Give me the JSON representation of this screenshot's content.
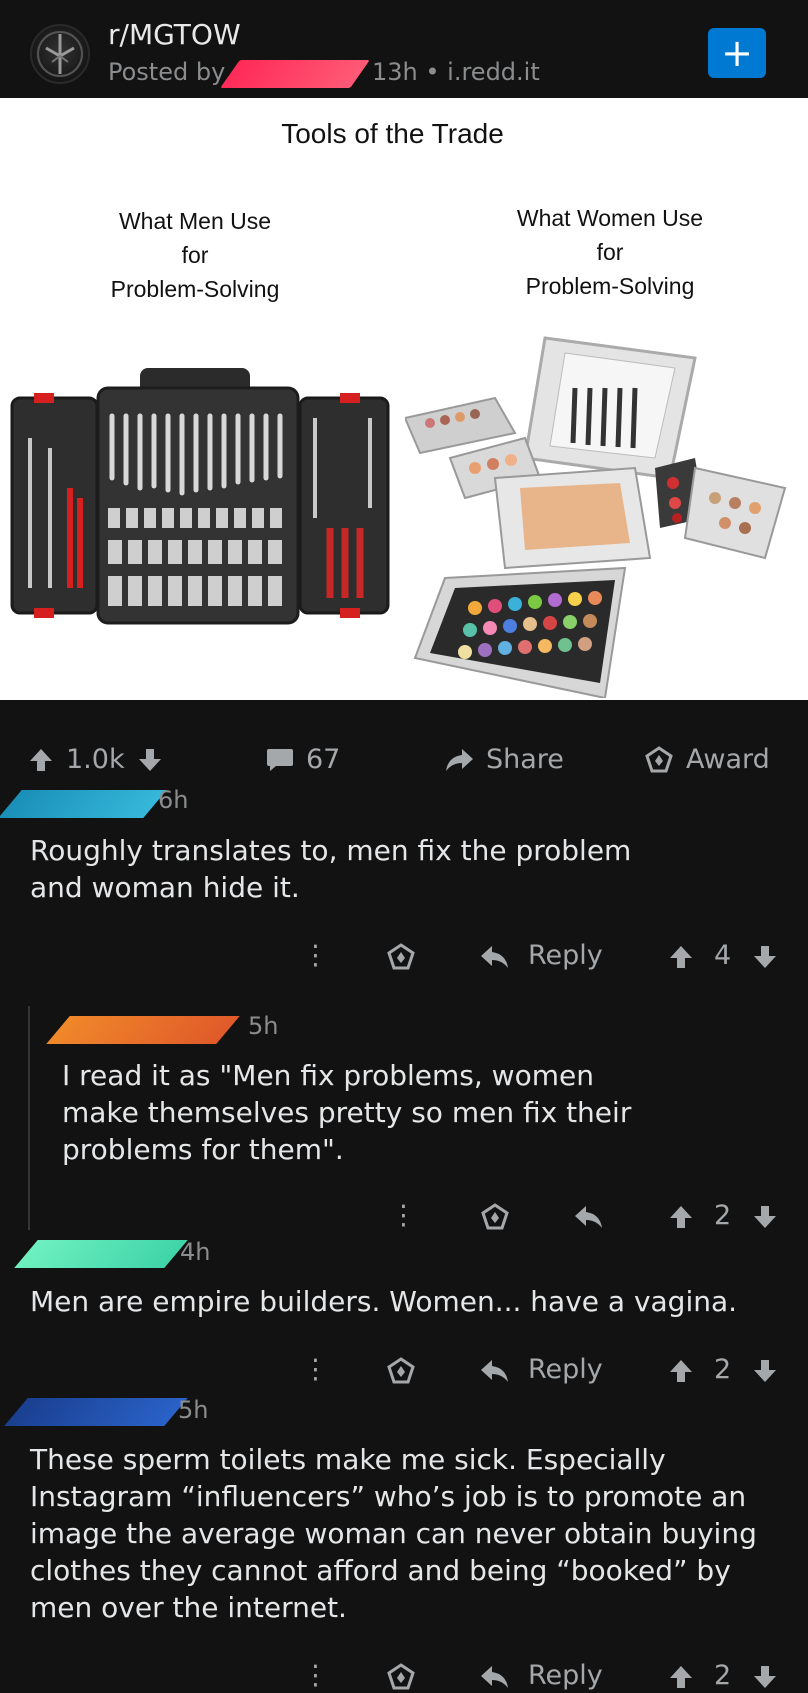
{
  "post": {
    "subreddit": "r/MGTOW",
    "posted_by_prefix": "Posted by",
    "age_domain": "13h • i.redd.it",
    "join_icon": "plus-icon"
  },
  "image": {
    "title": "Tools of the Trade",
    "left_label": [
      "What Men Use",
      "for",
      "Problem-Solving"
    ],
    "right_label": [
      "What Women Use",
      "for",
      "Problem-Solving"
    ]
  },
  "actions": {
    "upvotes": "1.0k",
    "comments": "67",
    "share": "Share",
    "award": "Award"
  },
  "comments": [
    {
      "time": "6h",
      "body": [
        "Roughly translates to, men fix the problem",
        "and woman hide it."
      ],
      "reply": "Reply",
      "votes": "4",
      "redact_color": "#2aa6c9"
    },
    {
      "time": "5h",
      "body": [
        "I read it as \"Men fix problems, women",
        "make themselves pretty so men fix their",
        "problems for them\"."
      ],
      "votes": "2",
      "redact_color": "#e8702a"
    },
    {
      "time": "4h",
      "body": [
        "Men are empire builders. Women... have a vagina."
      ],
      "reply": "Reply",
      "votes": "2",
      "redact_color": "#4fe0b0"
    },
    {
      "time": "5h",
      "body": [
        "These sperm toilets make me sick. Especially",
        "Instagram “influencers” who’s job is to promote an",
        "image the average woman can never obtain buying",
        "clothes they cannot afford and being “booked” by",
        "men over the internet."
      ],
      "reply": "Reply",
      "votes": "2",
      "redact_color": "#1a4fa8"
    }
  ],
  "colors": {
    "background": "#121212",
    "accent": "#0079d3",
    "redact_header": "#ff3b5c"
  }
}
